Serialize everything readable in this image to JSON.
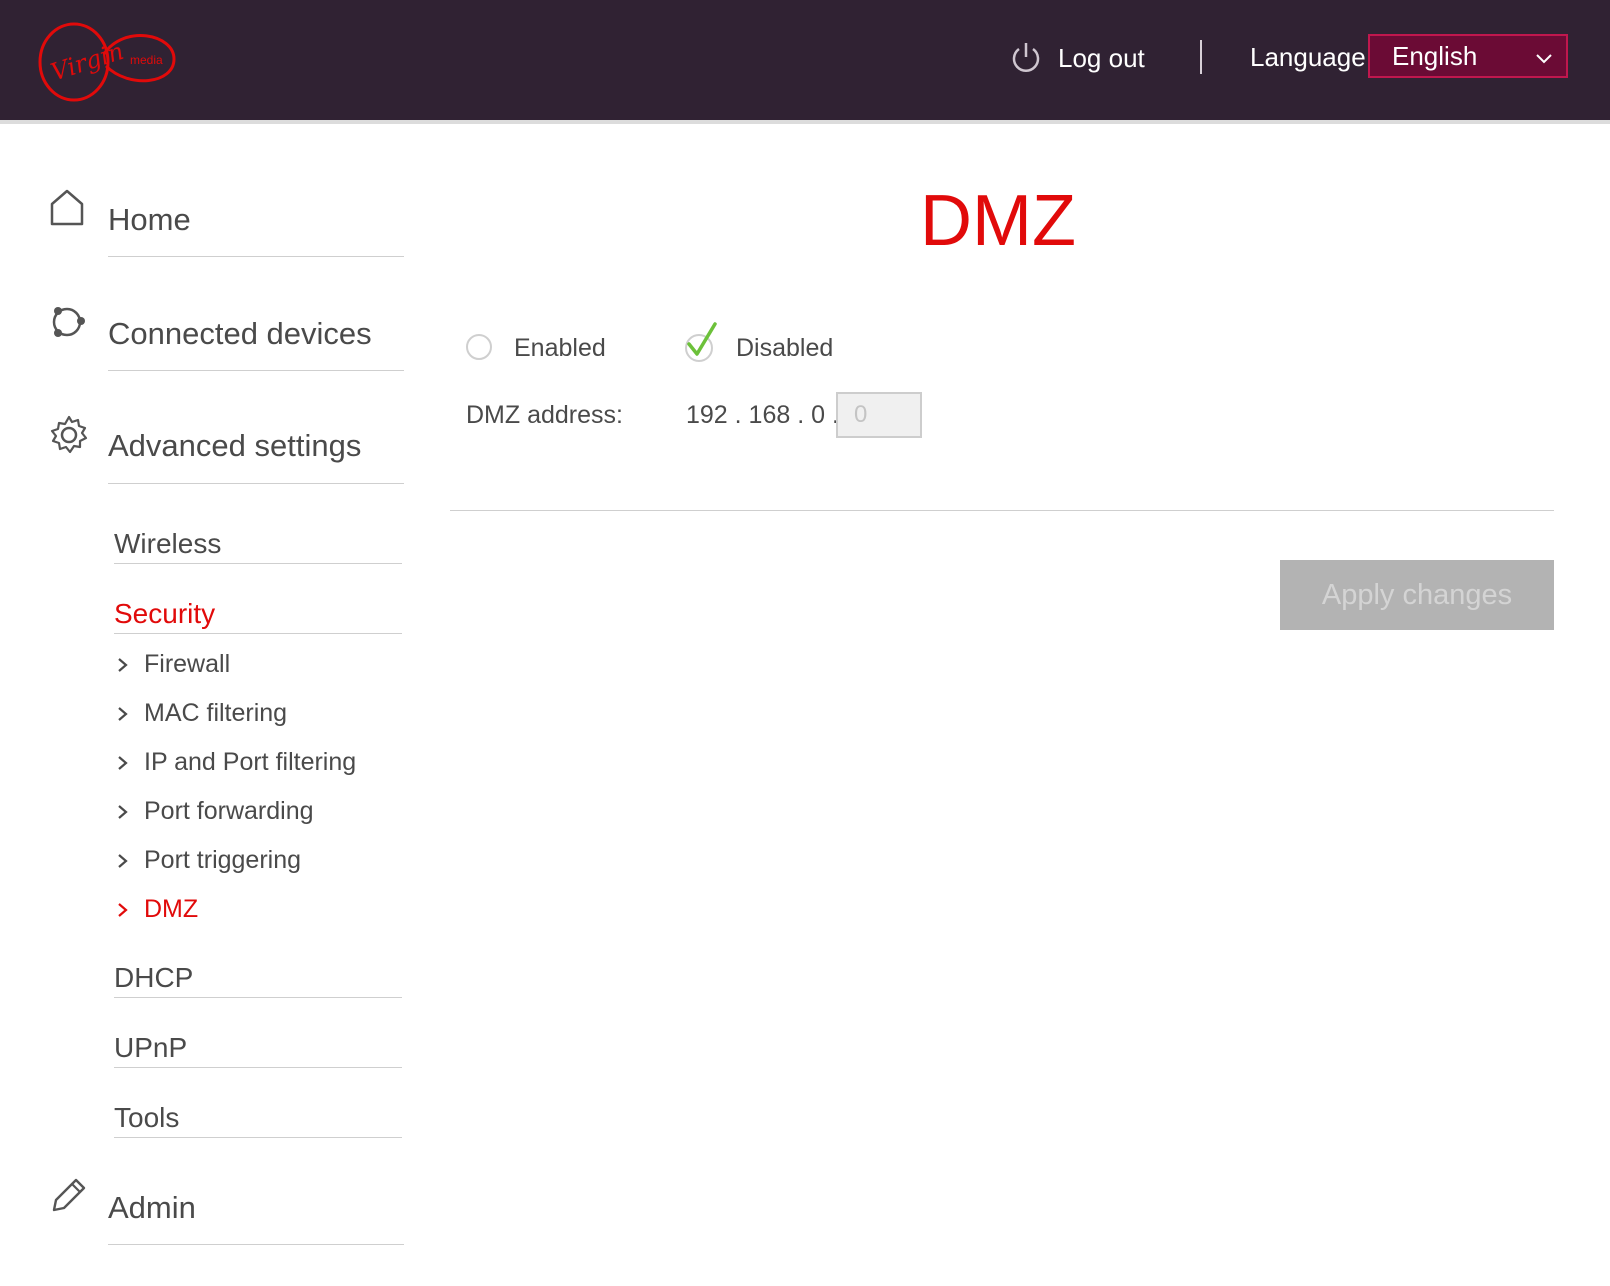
{
  "header": {
    "logo_alt": "Virgin media",
    "logout_label": "Log out",
    "language_label": "Language",
    "language_selected": "English"
  },
  "nav": {
    "home": "Home",
    "connected_devices": "Connected devices",
    "advanced_settings": "Advanced settings",
    "advanced_items": {
      "wireless": "Wireless",
      "security": "Security",
      "security_items": [
        "Firewall",
        "MAC filtering",
        "IP and Port filtering",
        "Port forwarding",
        "Port triggering",
        "DMZ"
      ],
      "dhcp": "DHCP",
      "upnp": "UPnP",
      "tools": "Tools"
    },
    "admin": "Admin"
  },
  "main": {
    "title": "DMZ",
    "enabled_label": "Enabled",
    "disabled_label": "Disabled",
    "selected_option": "Disabled",
    "address_label": "DMZ address:",
    "address_prefix": "192 . 168 . 0 .",
    "address_last_octet": "0",
    "apply_label": "Apply changes"
  },
  "colors": {
    "header_bg": "#302233",
    "accent_red": "#e10a0a",
    "language_select_bg": "#6b0b35",
    "check_green": "#6cc13a",
    "apply_disabled_bg": "#b3b3b3"
  }
}
